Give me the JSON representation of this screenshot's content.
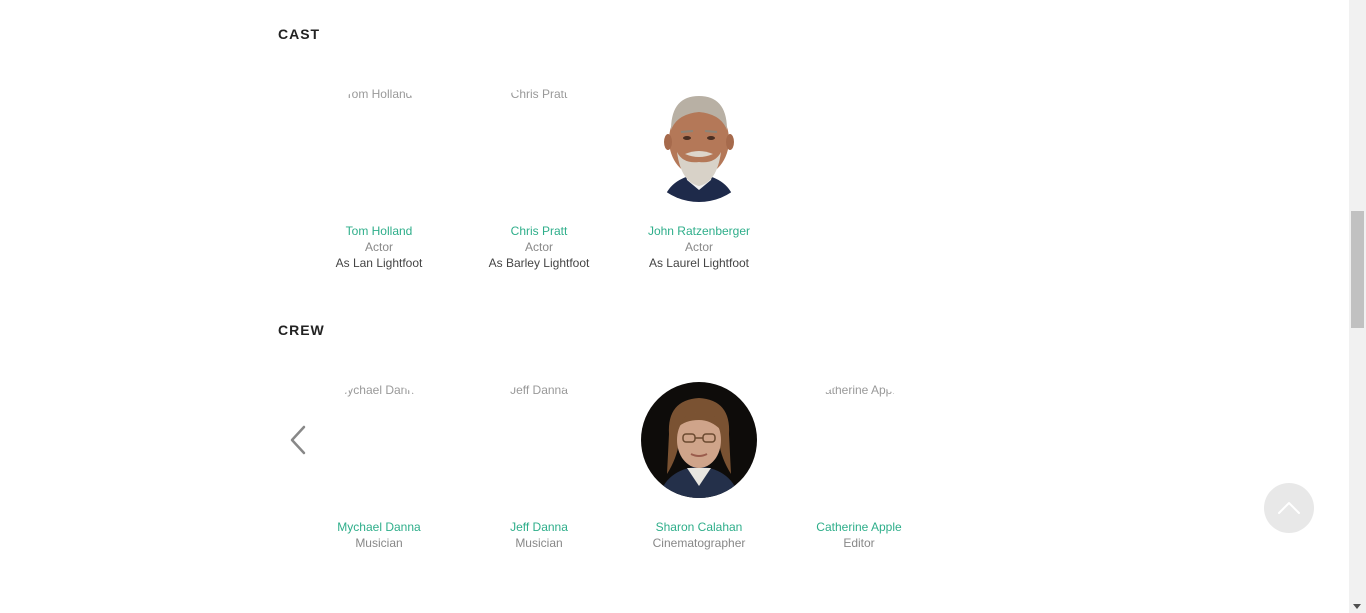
{
  "cast": {
    "title": "CAST",
    "members": [
      {
        "alt": "Tom Holland",
        "name": "Tom Holland",
        "role": "Actor",
        "character": "As Lan Lightfoot",
        "has_photo": false
      },
      {
        "alt": "Chris Pratt",
        "name": "Chris Pratt",
        "role": "Actor",
        "character": "As Barley Lightfoot",
        "has_photo": false
      },
      {
        "alt": "John Ratzenberger",
        "name": "John Ratzenberger",
        "role": "Actor",
        "character": "As Laurel Lightfoot",
        "has_photo": true
      }
    ]
  },
  "crew": {
    "title": "CREW",
    "members": [
      {
        "alt": "Mychael Danna",
        "name": "Mychael Danna",
        "role": "Musician",
        "has_photo": false
      },
      {
        "alt": "Jeff Danna",
        "name": "Jeff Danna",
        "role": "Musician",
        "has_photo": false
      },
      {
        "alt": "Sharon Calahan",
        "name": "Sharon Calahan",
        "role": "Cinematographer",
        "has_photo": true
      },
      {
        "alt": "Catherine Apple",
        "name": "Catherine Apple",
        "role": "Editor",
        "has_photo": false
      }
    ]
  },
  "icons": {
    "carousel_prev": "chevron-left-icon",
    "back_to_top": "chevron-up-icon"
  },
  "colors": {
    "link": "#2eae8a",
    "heading": "#222222"
  }
}
